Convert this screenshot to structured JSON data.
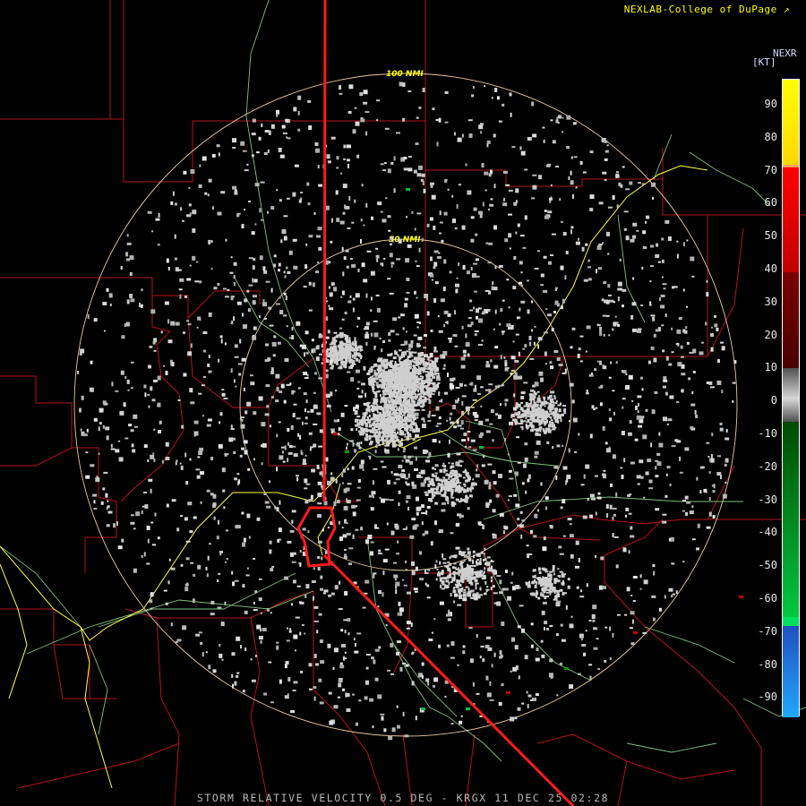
{
  "credit": "NEXLAB-College of DuPage",
  "credit_icon": "external-link-icon",
  "footer": "STORM RELATIVE VELOCITY 0.5 DEG - KRGX 11 DEC 25 02:28",
  "legend": {
    "product": "NEXR",
    "unit": "[KT]",
    "ticks": [
      "90",
      "80",
      "70",
      "60",
      "50",
      "40",
      "30",
      "20",
      "10",
      "0",
      "-10",
      "-20",
      "-30",
      "-40",
      "-50",
      "-60",
      "-70",
      "-80",
      "-90"
    ]
  },
  "rings": {
    "inner": "50 NMI",
    "outer": "100 NMI"
  },
  "colors": {
    "background": "#000000",
    "county_lines": "#c0121a",
    "highway": "#ffff40",
    "roads": "#7fbf7f",
    "range_rings": "#e8c8a0",
    "clutter": "#c8c8c8"
  }
}
